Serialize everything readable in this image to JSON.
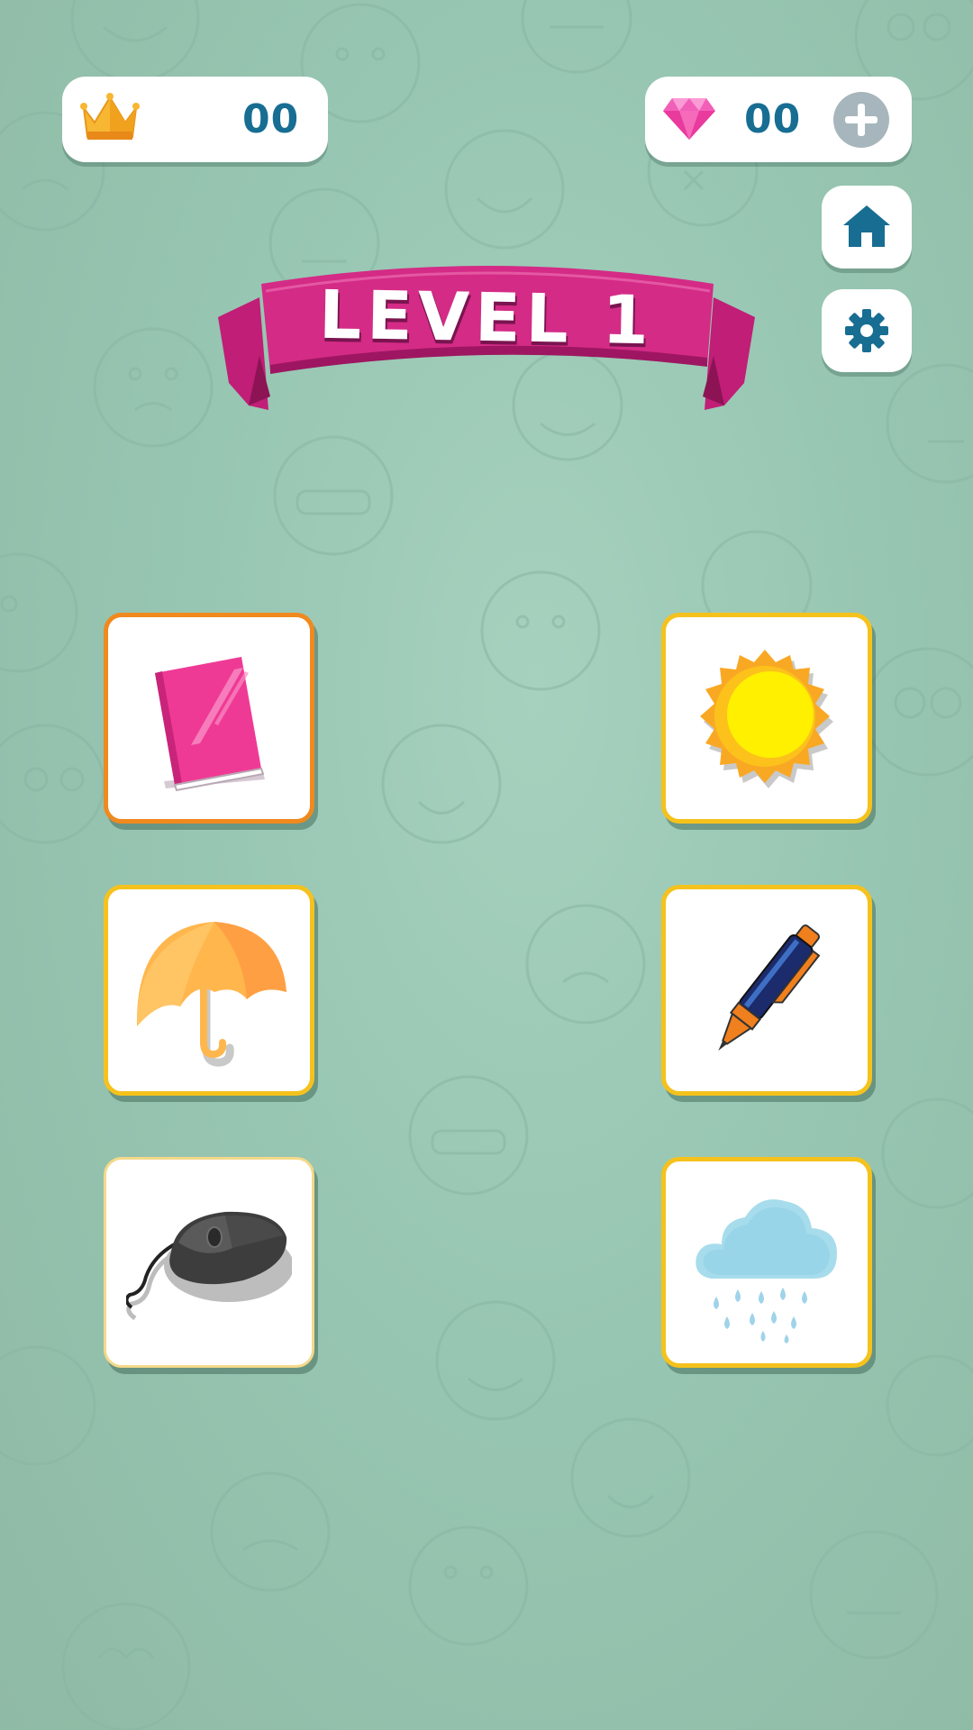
{
  "header": {
    "crown_count": "00",
    "gem_count": "00",
    "crown_icon": "crown-icon",
    "gem_icon": "gem-icon",
    "add_gems_icon": "plus-icon"
  },
  "buttons": {
    "home_icon": "home-icon",
    "settings_icon": "gear-icon"
  },
  "level": {
    "title": "LEVEL 1"
  },
  "cards": [
    {
      "item": "book",
      "state": "selected"
    },
    {
      "item": "sun",
      "state": "normal"
    },
    {
      "item": "umbrella",
      "state": "normal"
    },
    {
      "item": "pen",
      "state": "normal"
    },
    {
      "item": "computer-mouse",
      "state": "normal"
    },
    {
      "item": "rain-cloud",
      "state": "normal"
    }
  ],
  "colors": {
    "background": "#97c6b2",
    "counter_text": "#176d92",
    "banner": "#d42b86",
    "card_border": "#f5c21d",
    "card_selected_border": "#f0891e"
  }
}
